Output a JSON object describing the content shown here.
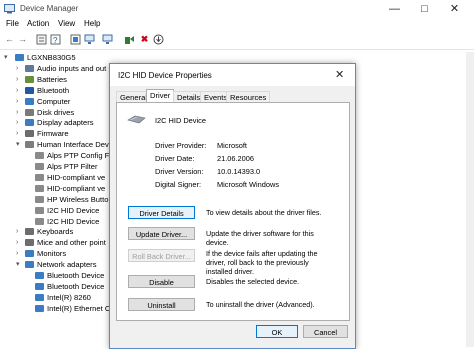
{
  "window": {
    "title": "Device Manager"
  },
  "menu": [
    "File",
    "Action",
    "View",
    "Help"
  ],
  "toolbar": [
    "back-arrow-icon",
    "forward-arrow-icon",
    "properties-icon",
    "help-icon",
    "scan-icon",
    "monitor-icon",
    "update-driver-icon",
    "uninstall-icon",
    "download-icon"
  ],
  "tree": {
    "root": "LGXNB830G5",
    "rows": [
      {
        "label": "Audio inputs and out",
        "icon": "audio-icon",
        "color": "#5c7a99"
      },
      {
        "label": "Batteries",
        "icon": "battery-icon",
        "color": "#6a8f3a"
      },
      {
        "label": "Bluetooth",
        "icon": "bluetooth-icon",
        "color": "#1e5aa8"
      },
      {
        "label": "Computer",
        "icon": "computer-icon",
        "color": "#3b7dc4"
      },
      {
        "label": "Disk drives",
        "icon": "disk-icon",
        "color": "#7a7a7a"
      },
      {
        "label": "Display adapters",
        "icon": "display-icon",
        "color": "#3b7dc4"
      },
      {
        "label": "Firmware",
        "icon": "firmware-icon",
        "color": "#6d6d6d"
      },
      {
        "label": "Human Interface Dev",
        "icon": "hid-icon",
        "color": "#7d7d7d",
        "expanded": true
      },
      {
        "label": "Alps PTP Config F",
        "icon": "hid-device-icon",
        "color": "#8a8a8a",
        "child": true
      },
      {
        "label": "Alps PTP Filter",
        "icon": "hid-device-icon",
        "color": "#8a8a8a",
        "child": true
      },
      {
        "label": "HID-compliant ve",
        "icon": "hid-device-icon",
        "color": "#8a8a8a",
        "child": true
      },
      {
        "label": "HID-compliant ve",
        "icon": "hid-device-icon",
        "color": "#8a8a8a",
        "child": true
      },
      {
        "label": "HP Wireless Butto",
        "icon": "hid-device-icon",
        "color": "#8a8a8a",
        "child": true
      },
      {
        "label": "I2C HID Device",
        "icon": "hid-device-icon",
        "color": "#8a8a8a",
        "child": true
      },
      {
        "label": "I2C HID Device",
        "icon": "hid-device-icon",
        "color": "#8a8a8a",
        "child": true
      },
      {
        "label": "Keyboards",
        "icon": "keyboard-icon",
        "color": "#6d6d6d"
      },
      {
        "label": "Mice and other point",
        "icon": "mouse-icon",
        "color": "#6d6d6d"
      },
      {
        "label": "Monitors",
        "icon": "monitor-icon",
        "color": "#3b7dc4"
      },
      {
        "label": "Network adapters",
        "icon": "network-icon",
        "color": "#3b7dc4",
        "expanded": true
      },
      {
        "label": "Bluetooth Device",
        "icon": "network-adapter-icon",
        "color": "#3b7dc4",
        "child": true
      },
      {
        "label": "Bluetooth Device",
        "icon": "network-adapter-icon",
        "color": "#3b7dc4",
        "child": true
      },
      {
        "label": "Intel(R) 8260",
        "icon": "network-adapter-icon",
        "color": "#3b7dc4",
        "child": true
      },
      {
        "label": "Intel(R) Ethernet C",
        "icon": "network-adapter-icon",
        "color": "#3b7dc4",
        "child": true
      }
    ]
  },
  "dialog": {
    "title": "I2C HID Device Properties",
    "tabs": [
      "General",
      "Driver",
      "Details",
      "Events",
      "Resources"
    ],
    "active_tab": "Driver",
    "device_name": "I2C HID Device",
    "fields": [
      {
        "label": "Driver Provider:",
        "value": "Microsoft"
      },
      {
        "label": "Driver Date:",
        "value": "21.06.2006"
      },
      {
        "label": "Driver Version:",
        "value": "10.0.14393.0"
      },
      {
        "label": "Digital Signer:",
        "value": "Microsoft Windows"
      }
    ],
    "actions": [
      {
        "button": "Driver Details",
        "desc": "To view details about the driver files.",
        "state": "focused"
      },
      {
        "button": "Update Driver...",
        "desc": "Update the driver software for this device.",
        "state": "normal"
      },
      {
        "button": "Roll Back Driver...",
        "desc": "If the device fails after updating the driver, roll back to the previously installed driver.",
        "state": "disabled"
      },
      {
        "button": "Disable",
        "desc": "Disables the selected device.",
        "state": "normal"
      },
      {
        "button": "Uninstall",
        "desc": "To uninstall the driver (Advanced).",
        "state": "normal"
      }
    ],
    "ok_label": "OK",
    "cancel_label": "Cancel"
  }
}
